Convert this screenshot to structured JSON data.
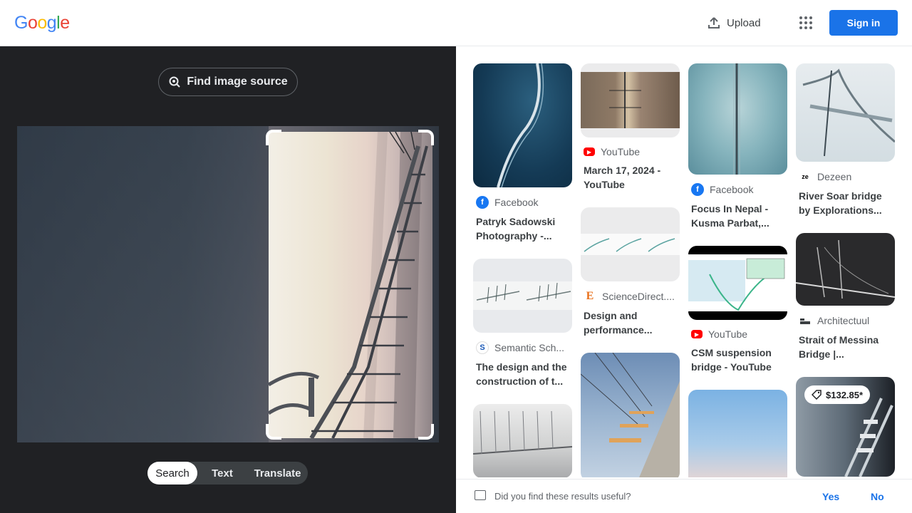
{
  "header": {
    "logo": [
      "G",
      "o",
      "o",
      "g",
      "l",
      "e"
    ],
    "logo_colors": [
      "#4285F4",
      "#EA4335",
      "#FBBC05",
      "#4285F4",
      "#34A853",
      "#EA4335"
    ],
    "upload_label": "Upload",
    "signin_label": "Sign in"
  },
  "lens": {
    "find_source_label": "Find image source",
    "tabs": [
      "Search",
      "Text",
      "Translate"
    ],
    "active_tab": "Search"
  },
  "results": {
    "col1": [
      {
        "source": "Facebook",
        "source_icon": "facebook-icon",
        "title": "Patryk Sadowski Photography -..."
      },
      {
        "source": "Semantic Sch...",
        "source_icon": "semantic-scholar-icon",
        "title": "The design and the construction of t..."
      }
    ],
    "col2": [
      {
        "source": "YouTube",
        "source_icon": "youtube-icon",
        "title": "March 17, 2024 - YouTube"
      },
      {
        "source": "ScienceDirect....",
        "source_icon": "sciencedirect-icon",
        "title": "Design and performance..."
      }
    ],
    "col3": [
      {
        "source": "Facebook",
        "source_icon": "facebook-icon",
        "title": "Focus In Nepal - Kusma Parbat,..."
      },
      {
        "source": "YouTube",
        "source_icon": "youtube-icon",
        "title": "CSM suspension bridge - YouTube"
      }
    ],
    "col4": [
      {
        "source": "Dezeen",
        "source_icon": "dezeen-icon",
        "title": "River Soar bridge by Explorations..."
      },
      {
        "source": "Architectuul",
        "source_icon": "architectuul-icon",
        "title": "Strait of Messina Bridge |..."
      },
      {
        "price": "$132.85*"
      }
    ]
  },
  "feedback": {
    "question": "Did you find these results useful?",
    "yes": "Yes",
    "no": "No"
  }
}
